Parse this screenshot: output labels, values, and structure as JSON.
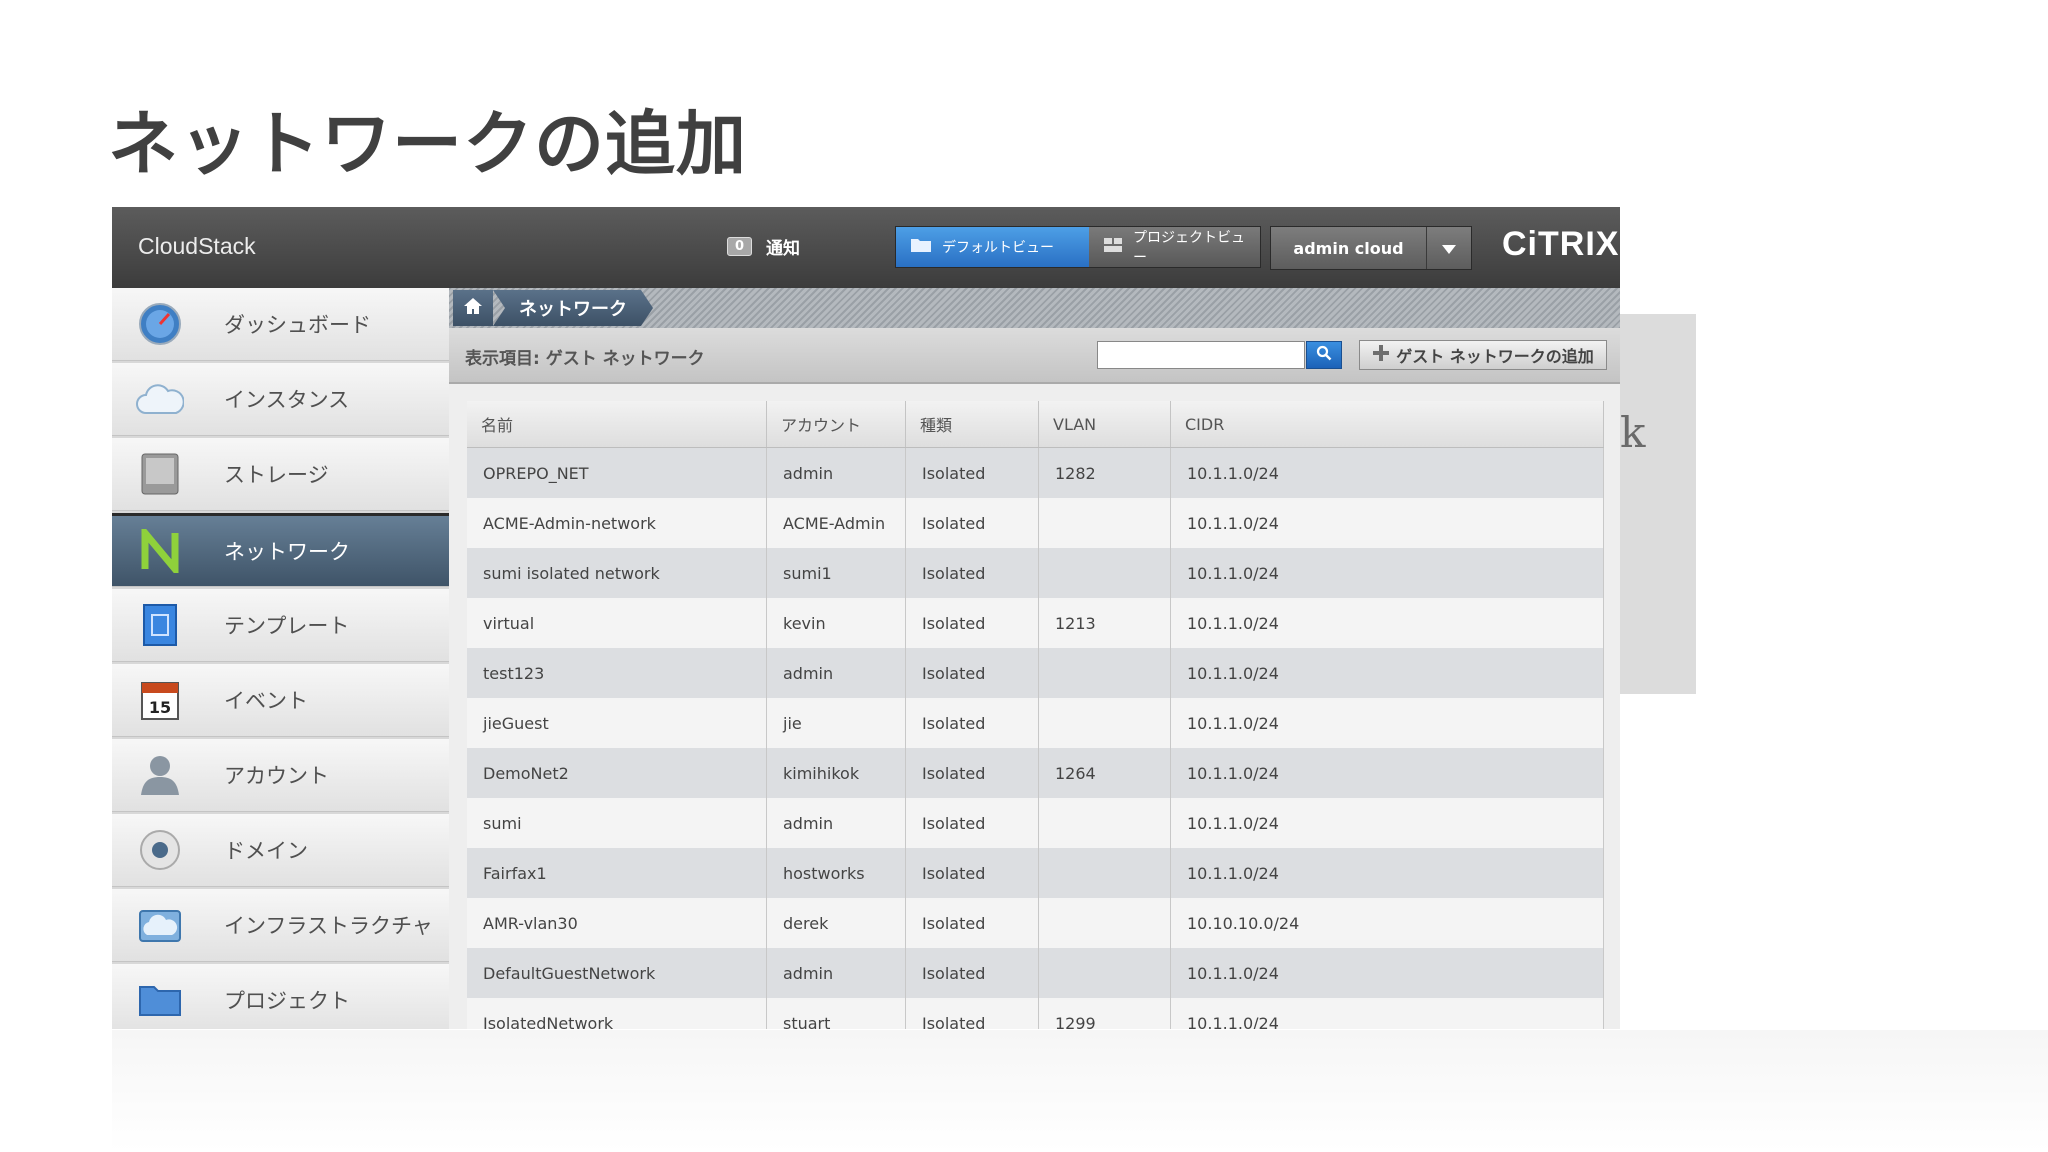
{
  "slide": {
    "title": "ネットワークの追加",
    "background_text": "k"
  },
  "header": {
    "brand": "CloudStack",
    "notifications": {
      "count": "0",
      "label": "通知"
    },
    "views": {
      "default": "デフォルトビュー",
      "project": "プロジェクトビュー"
    },
    "user": "admin cloud",
    "logo": "CiTRIX"
  },
  "sidebar": {
    "items": [
      {
        "label": "ダッシュボード",
        "icon": "dashboard-icon"
      },
      {
        "label": "インスタンス",
        "icon": "cloud-icon"
      },
      {
        "label": "ストレージ",
        "icon": "storage-icon"
      },
      {
        "label": "ネットワーク",
        "icon": "network-icon",
        "active": true
      },
      {
        "label": "テンプレート",
        "icon": "template-icon"
      },
      {
        "label": "イベント",
        "icon": "calendar-icon",
        "calendar_day": "15"
      },
      {
        "label": "アカウント",
        "icon": "user-icon"
      },
      {
        "label": "ドメイン",
        "icon": "domain-icon"
      },
      {
        "label": "インフラストラクチャ",
        "icon": "infrastructure-icon"
      },
      {
        "label": "プロジェクト",
        "icon": "folder-icon"
      }
    ]
  },
  "breadcrumb": {
    "current": "ネットワーク"
  },
  "toolbar": {
    "filter_label": "表示項目: ゲスト ネットワーク",
    "search_placeholder": "",
    "add_button": "ゲスト ネットワークの追加"
  },
  "table": {
    "columns": [
      "名前",
      "アカウント",
      "種類",
      "VLAN",
      "CIDR"
    ],
    "rows": [
      [
        "OPREPO_NET",
        "admin",
        "Isolated",
        "1282",
        "10.1.1.0/24"
      ],
      [
        "ACME-Admin-network",
        "ACME-Admin",
        "Isolated",
        "",
        "10.1.1.0/24"
      ],
      [
        "sumi isolated network",
        "sumi1",
        "Isolated",
        "",
        "10.1.1.0/24"
      ],
      [
        "virtual",
        "kevin",
        "Isolated",
        "1213",
        "10.1.1.0/24"
      ],
      [
        "test123",
        "admin",
        "Isolated",
        "",
        "10.1.1.0/24"
      ],
      [
        "jieGuest",
        "jie",
        "Isolated",
        "",
        "10.1.1.0/24"
      ],
      [
        "DemoNet2",
        "kimihikok",
        "Isolated",
        "1264",
        "10.1.1.0/24"
      ],
      [
        "sumi",
        "admin",
        "Isolated",
        "",
        "10.1.1.0/24"
      ],
      [
        "Fairfax1",
        "hostworks",
        "Isolated",
        "",
        "10.1.1.0/24"
      ],
      [
        "AMR-vlan30",
        "derek",
        "Isolated",
        "",
        "10.10.10.0/24"
      ],
      [
        "DefaultGuestNetwork",
        "admin",
        "Isolated",
        "",
        "10.1.1.0/24"
      ],
      [
        "IsolatedNetwork",
        "stuart",
        "Isolated",
        "1299",
        "10.1.1.0/24"
      ]
    ]
  },
  "colors": {
    "accent": "#2a70c4",
    "nav_active": "#4f6478",
    "topbar": "#4a4a4a"
  }
}
